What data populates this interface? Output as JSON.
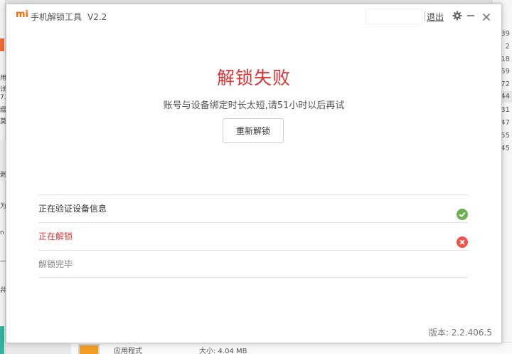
{
  "app": {
    "logo_text": "mi",
    "title": "手机解锁工具",
    "version_label": "V2.2",
    "logout_label": "退出",
    "icons": {
      "settings": "gear-icon",
      "minimize": "minimize-icon",
      "close": "close-icon"
    }
  },
  "result": {
    "title": "解锁失败",
    "message": "账号与设备绑定时长太短,请51小时以后再试",
    "retry_label": "重新解锁",
    "title_color": "#e03232"
  },
  "steps": [
    {
      "label": "正在验证设备信息",
      "status": "success",
      "icon": "check-circle-icon",
      "color": "#6ab04c"
    },
    {
      "label": "正在解锁",
      "status": "failed",
      "icon": "error-circle-icon",
      "color": "#f0524b"
    },
    {
      "label": "解锁完毕",
      "status": "pending"
    }
  ],
  "footer": {
    "version": "版本: 2.2.406.5"
  },
  "background": {
    "right_numbers": [
      "39",
      "2",
      "18",
      "59",
      "72",
      "44",
      "31",
      "47",
      "55",
      "45"
    ],
    "bottom_texts": [
      "应用程式",
      "大小: 4.04 MB"
    ],
    "left_glyphs": [
      "用",
      "详",
      "7.",
      "缀",
      "莫",
      "剥",
      "为",
      "n",
      "一",
      "井"
    ]
  }
}
